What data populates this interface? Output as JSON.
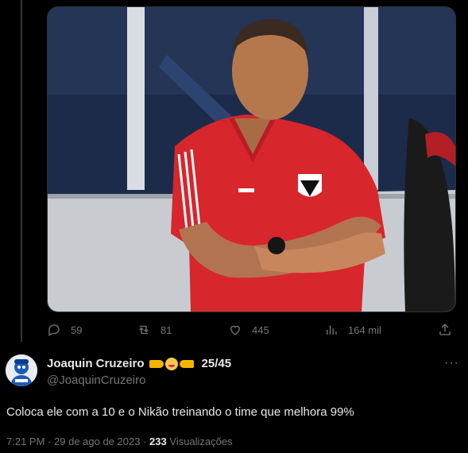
{
  "media": {
    "alt": ""
  },
  "actions": {
    "replies": "59",
    "retweets": "81",
    "likes": "445",
    "views": "164 mil"
  },
  "author": {
    "name": "Joaquin Cruzeiro",
    "tweet_counter": "25/45",
    "handle": "@JoaquinCruzeiro"
  },
  "tweet": {
    "text": "Coloca ele com a 10 e o Nikão treinando o time que melhora 99%",
    "time": "7:21 PM",
    "separator": "·",
    "date": "29 de ago de 2023",
    "views_count": "233",
    "views_label": "Visualizações"
  },
  "colors": {
    "muted": "#71767b",
    "text": "#e7e9ea",
    "jersey_red": "#d7262c",
    "background": "#000000"
  },
  "icons": [
    "reply-icon",
    "retweet-icon",
    "like-icon",
    "views-icon",
    "share-icon",
    "more-icon"
  ]
}
